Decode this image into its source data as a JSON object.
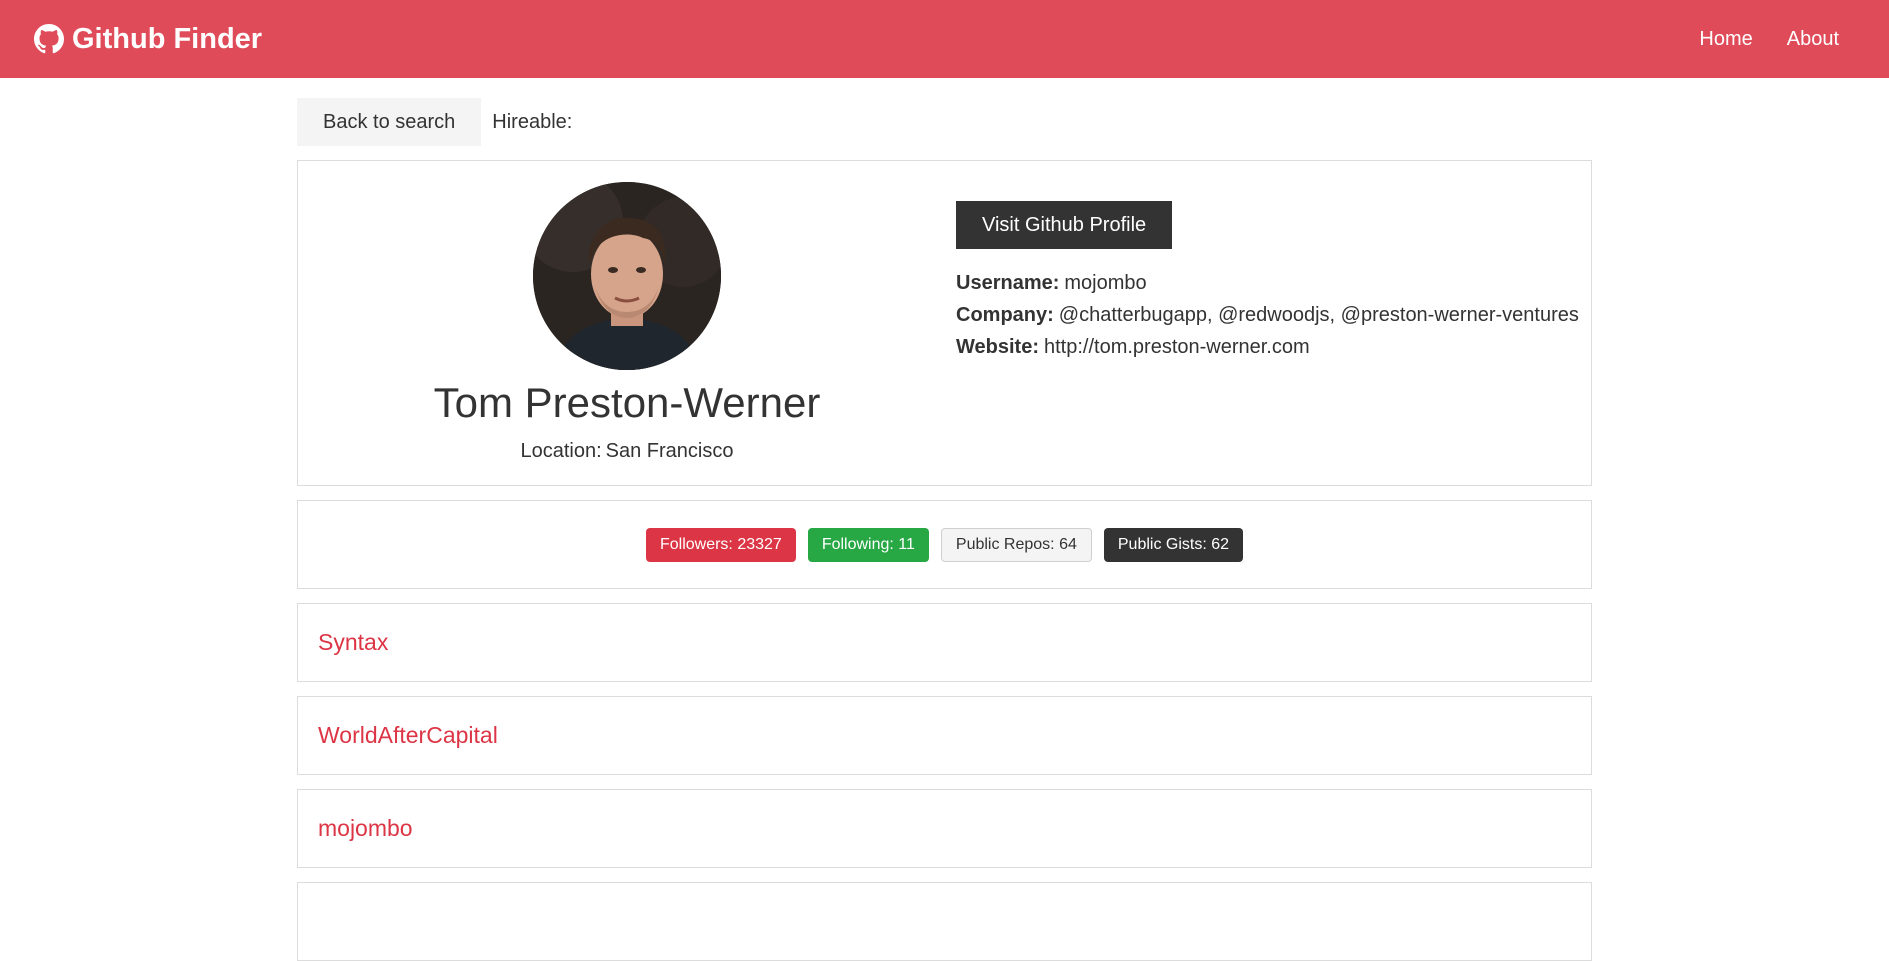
{
  "navbar": {
    "brand": "Github Finder",
    "links": [
      {
        "label": "Home"
      },
      {
        "label": "About"
      }
    ]
  },
  "topbar": {
    "back_label": "Back to search",
    "hireable_label": "Hireable:"
  },
  "profile": {
    "name": "Tom Preston-Werner",
    "location_label": "Location:",
    "location": "San Francisco",
    "visit_button": "Visit Github Profile",
    "username_label": "Username:",
    "username": "mojombo",
    "company_label": "Company:",
    "company": "@chatterbugapp, @redwoodjs, @preston-werner-ventures",
    "website_label": "Website:",
    "website": "http://tom.preston-werner.com"
  },
  "stats": {
    "followers": "Followers: 23327",
    "following": "Following: 11",
    "public_repos": "Public Repos: 64",
    "public_gists": "Public Gists: 62"
  },
  "repos": [
    {
      "name": "Syntax"
    },
    {
      "name": "WorldAfterCapital"
    },
    {
      "name": "mojombo"
    }
  ],
  "colors": {
    "navbar": "#e04b5a",
    "primary": "#dc3545",
    "success": "#28a745",
    "dark": "#333333",
    "light": "#f4f4f4"
  }
}
